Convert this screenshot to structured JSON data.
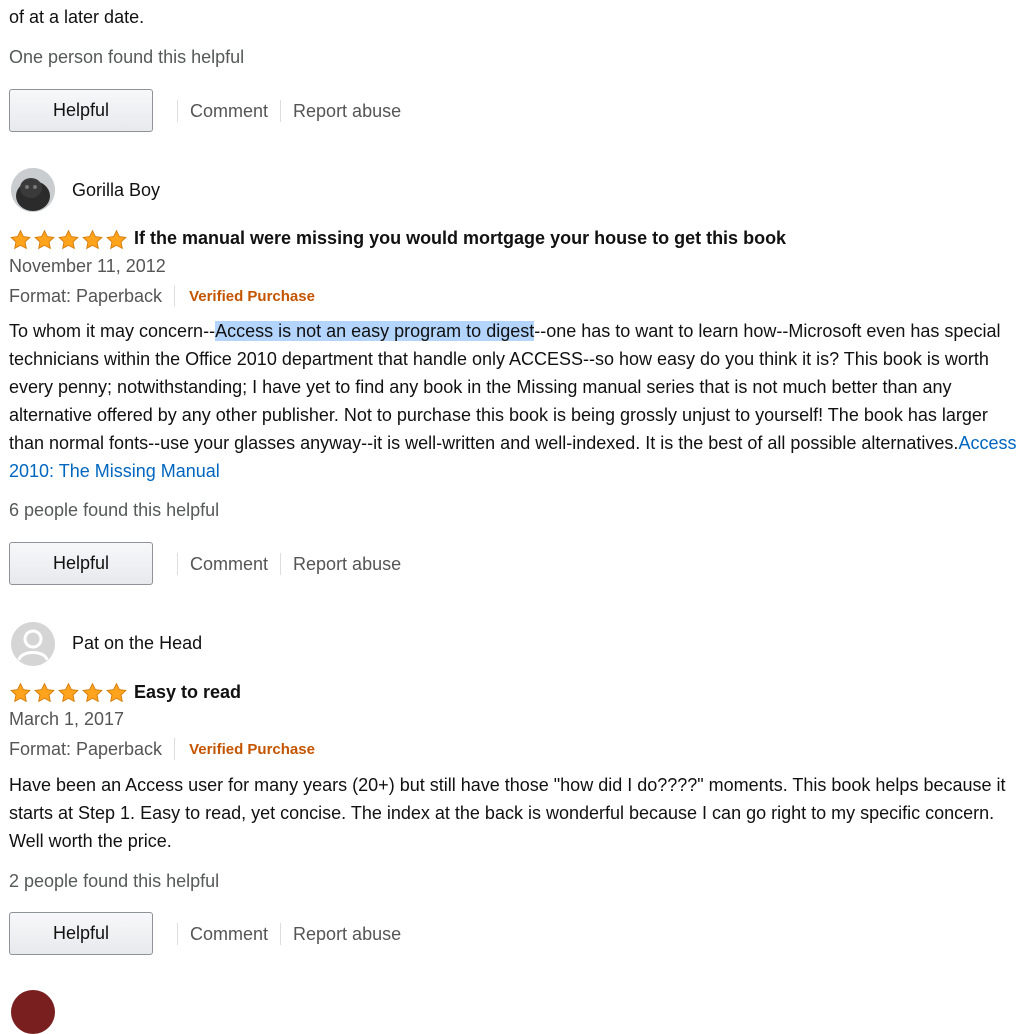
{
  "top_fragment": "of at a later date.",
  "colors": {
    "star": "#ffa41c",
    "verified": "#c45500",
    "link": "#0066c0",
    "highlight": "#b3d4fc"
  },
  "reviews": [
    {
      "helpful_count_text": "One person found this helpful",
      "actions": {
        "helpful": "Helpful",
        "comment": "Comment",
        "report": "Report abuse"
      }
    },
    {
      "reviewer": "Gorilla Boy",
      "avatar_icon": "user-photo-icon",
      "rating": 5,
      "title": "If the manual were missing you would mortgage your house to get this book",
      "date": "November 11, 2012",
      "format": "Format: Paperback",
      "verified": "Verified Purchase",
      "body": {
        "before": "To whom it may concern--",
        "highlight": "Access is not an easy program to digest",
        "after": "--one has to want to learn how--Microsoft even has special technicians within the Office 2010 department that handle only ACCESS--so how easy do you think it is? This book is worth every penny; notwithstanding; I have yet to find any book in the Missing manual series that is not much better than any alternative offered by any other publisher. Not to purchase this book is being grossly unjust to yourself! The book has larger than normal fonts--use your glasses anyway--it is well-written and well-indexed. It is the best of all possible alternatives.",
        "link": "Access 2010: The Missing Manual"
      },
      "helpful_count_text": "6 people found this helpful",
      "actions": {
        "helpful": "Helpful",
        "comment": "Comment",
        "report": "Report abuse"
      }
    },
    {
      "reviewer": "Pat on the Head",
      "avatar_icon": "default-avatar-icon",
      "rating": 5,
      "title": "Easy to read",
      "date": "March 1, 2017",
      "format": "Format: Paperback",
      "verified": "Verified Purchase",
      "body": {
        "text": "Have been an Access user for many years (20+) but still have those \"how did I do????\" moments. This book helps because it starts at Step 1. Easy to read, yet concise. The index at the back is wonderful because I can go right to my specific concern. Well worth the price."
      },
      "helpful_count_text": "2 people found this helpful",
      "actions": {
        "helpful": "Helpful",
        "comment": "Comment",
        "report": "Report abuse"
      }
    }
  ]
}
